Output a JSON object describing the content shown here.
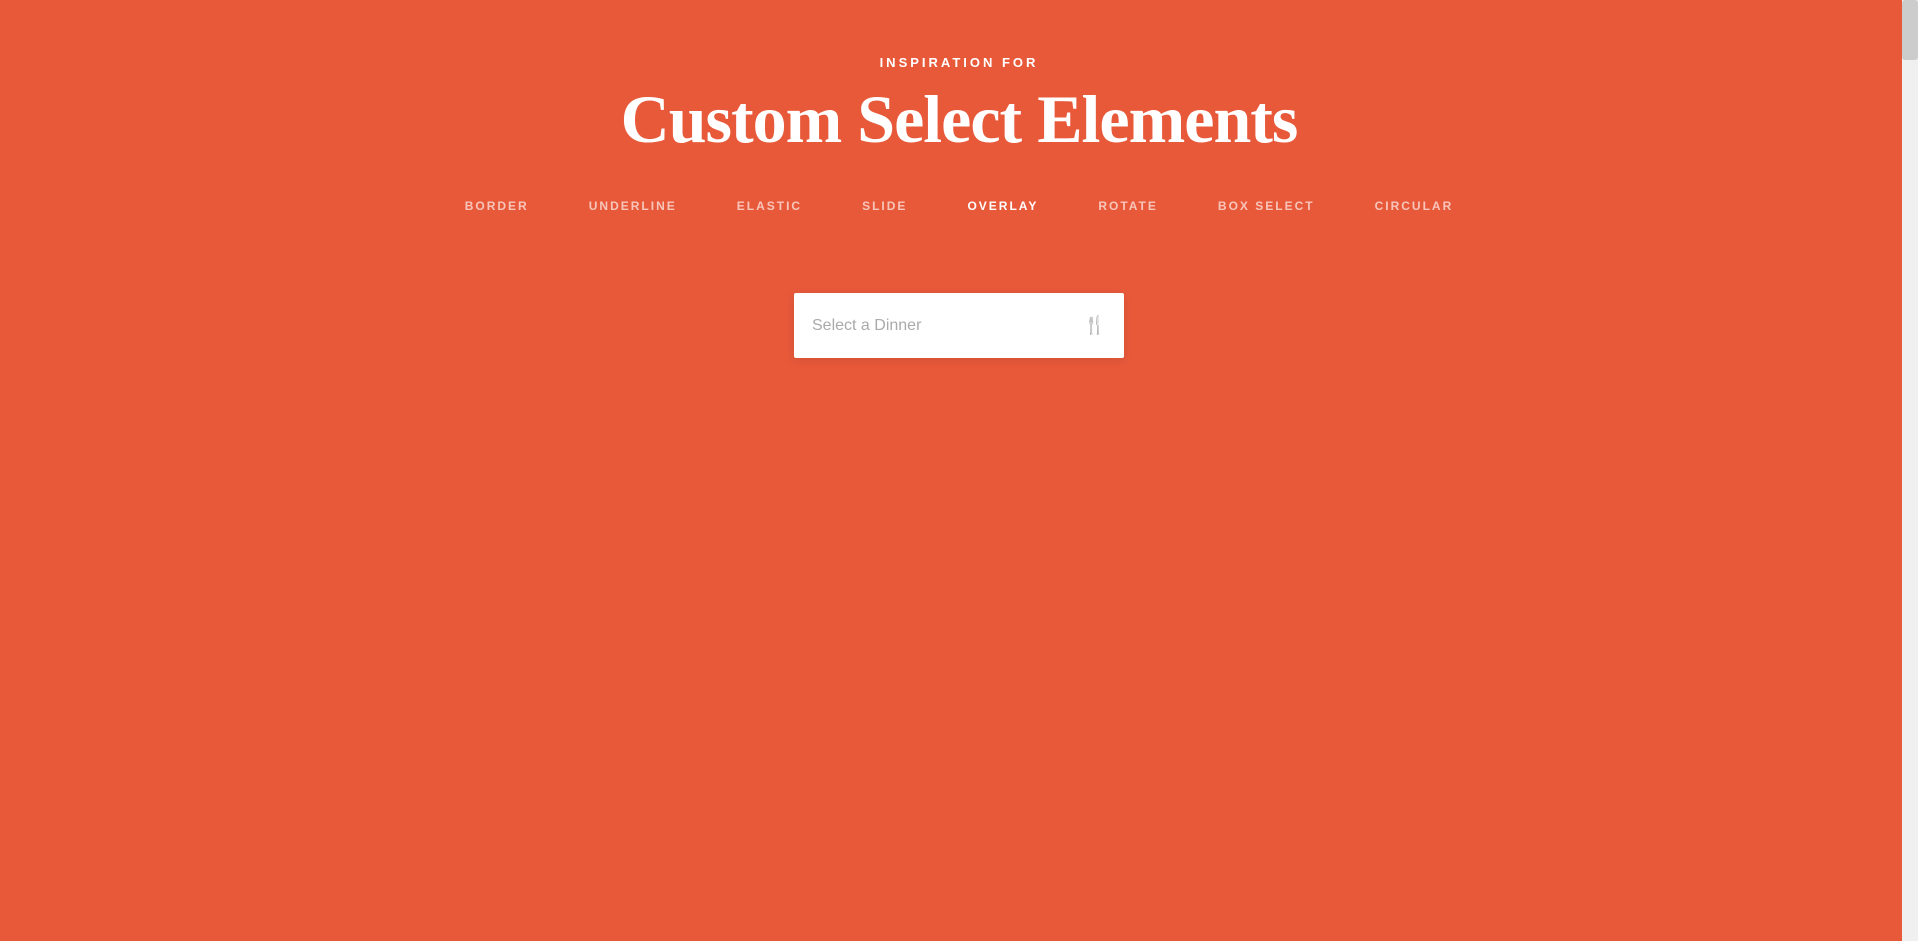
{
  "header": {
    "subtitle": "INSPIRATION FOR",
    "title": "Custom Select Elements"
  },
  "nav": {
    "items": [
      {
        "id": "border",
        "label": "BORDER",
        "active": false
      },
      {
        "id": "underline",
        "label": "UNDERLINE",
        "active": false
      },
      {
        "id": "elastic",
        "label": "ELASTIC",
        "active": false
      },
      {
        "id": "slide",
        "label": "SLIDE",
        "active": false
      },
      {
        "id": "overlay",
        "label": "OVERLAY",
        "active": true
      },
      {
        "id": "rotate",
        "label": "ROTATE",
        "active": false
      },
      {
        "id": "box-select",
        "label": "BOX SELECT",
        "active": false
      },
      {
        "id": "circular",
        "label": "CIRCULAR",
        "active": false
      }
    ]
  },
  "select": {
    "placeholder": "Select a Dinner",
    "icon": "🍴"
  },
  "colors": {
    "background": "#e8593a",
    "text_primary": "#ffffff",
    "text_muted": "rgba(255,255,255,0.65)",
    "select_bg": "#ffffff",
    "select_text": "#aaaaaa"
  }
}
